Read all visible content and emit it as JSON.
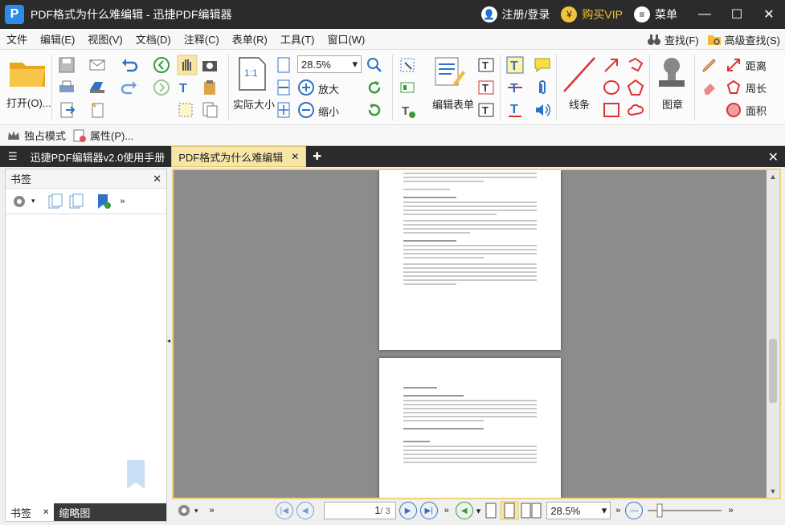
{
  "window": {
    "title": "PDF格式为什么难编辑 - 迅捷PDF编辑器",
    "logo_letter": "P",
    "login": "注册/登录",
    "buy_vip": "购买VIP",
    "menu": "菜单"
  },
  "menubar": {
    "items": [
      "文件",
      "编辑(E)",
      "视图(V)",
      "文档(D)",
      "注释(C)",
      "表单(R)",
      "工具(T)",
      "窗口(W)"
    ],
    "find": "查找(F)",
    "advanced_find": "高级查找(S)"
  },
  "ribbon": {
    "open": "打开(O)...",
    "actual_size": "实际大小",
    "actual_size_icon": "1:1",
    "zoom_value": "28.5%",
    "zoom_in": "放大",
    "zoom_out": "缩小",
    "edit_form": "编辑表单",
    "line": "线条",
    "stamp": "图章",
    "distance": "距离",
    "perimeter": "周长",
    "area": "面积"
  },
  "modebar": {
    "exclusive_mode": "独占模式",
    "properties": "属性(P)..."
  },
  "tabs": [
    {
      "label": "迅捷PDF编辑器v2.0使用手册",
      "active": false
    },
    {
      "label": "PDF格式为什么难编辑",
      "active": true
    }
  ],
  "left_panel": {
    "title": "书签",
    "tabs": [
      "书签",
      "缩略图"
    ]
  },
  "bottombar": {
    "page_value": "1",
    "page_total": "/ 3",
    "zoom": "28.5%"
  },
  "colors": {
    "accent": "#f7e6a8",
    "titlebar": "#2b2b2b",
    "vip": "#f2c23a"
  }
}
